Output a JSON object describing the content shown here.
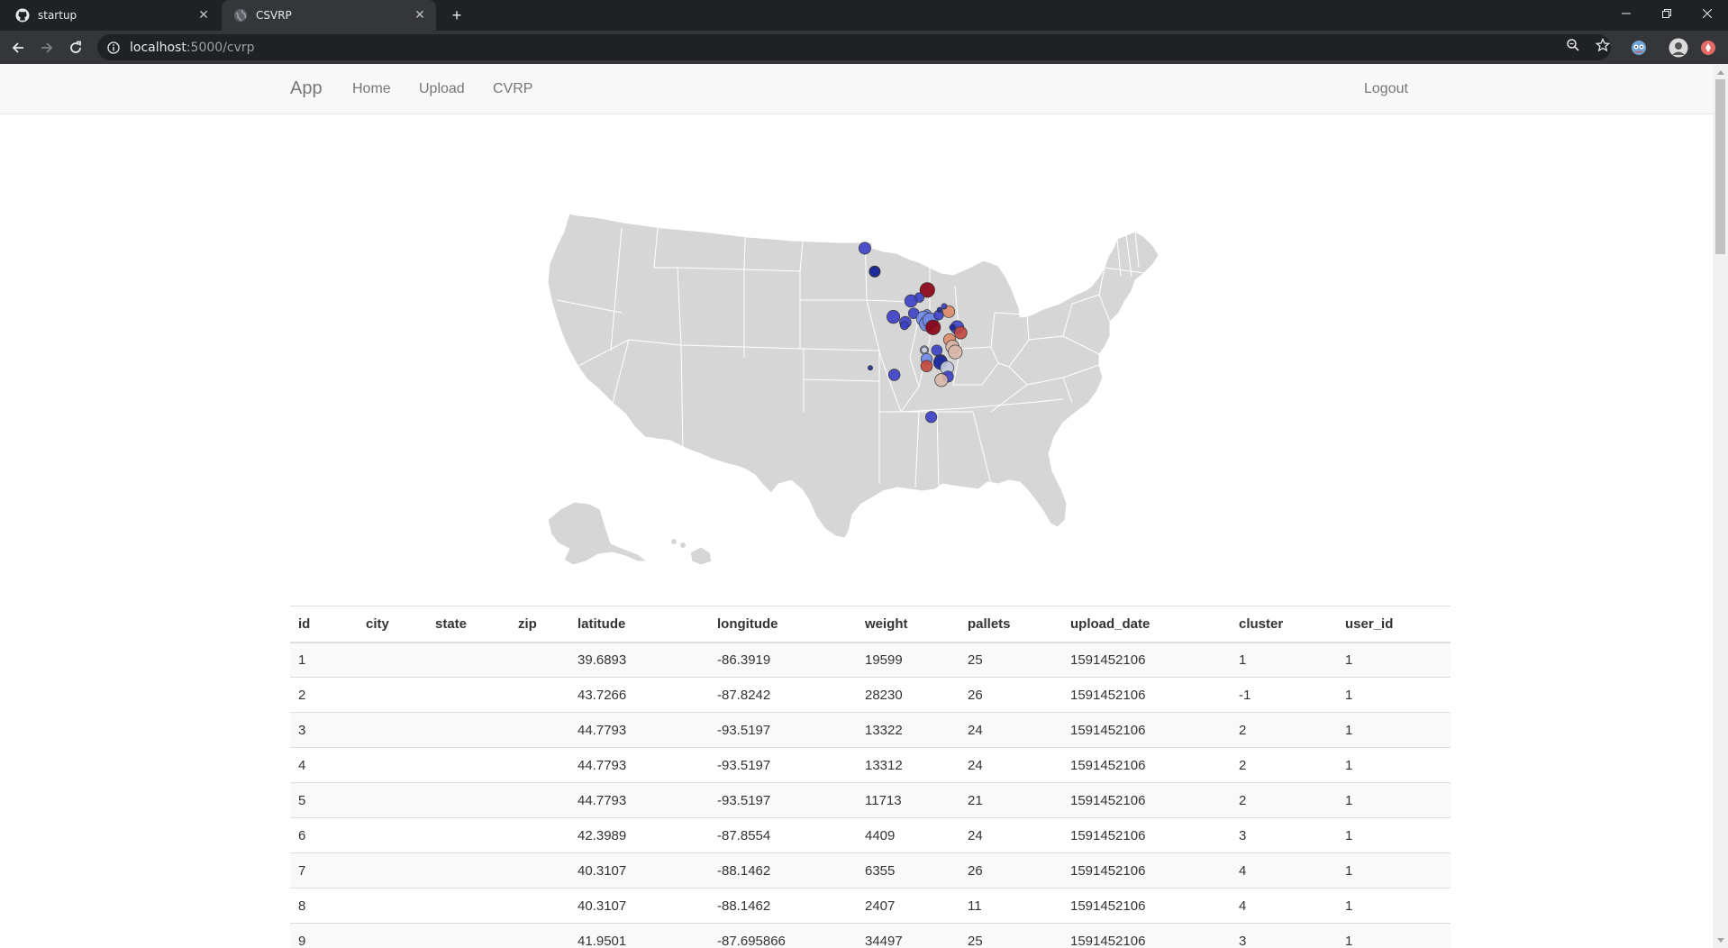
{
  "browser": {
    "tabs": [
      {
        "title": "startup",
        "icon": "github-icon"
      },
      {
        "title": "CSVRP",
        "icon": "globe-icon",
        "active": true
      }
    ],
    "url_host": "localhost",
    "url_path": ":5000/cvrp"
  },
  "navbar": {
    "brand": "App",
    "links": [
      "Home",
      "Upload",
      "CVRP"
    ],
    "logout": "Logout"
  },
  "map": {
    "title": "",
    "base_color": "#d6d6d6",
    "border_color": "#ffffff",
    "cluster_colors": {
      "-1": "#8b0012",
      "1": "#3b3fc7",
      "2": "#1d2a9b",
      "3": "#6f88e6",
      "4": "#c4cbe0",
      "5": "#e08a6a",
      "6": "#d9b8a8",
      "7": "#c4473d"
    },
    "points": [
      {
        "lat": 39.6893,
        "lon": -86.3919,
        "weight": 19599,
        "cluster": 1
      },
      {
        "lat": 43.7266,
        "lon": -87.8242,
        "weight": 28230,
        "cluster": -1
      },
      {
        "lat": 44.7793,
        "lon": -93.5197,
        "weight": 13322,
        "cluster": 2
      },
      {
        "lat": 44.7793,
        "lon": -93.5197,
        "weight": 13312,
        "cluster": 2
      },
      {
        "lat": 44.7793,
        "lon": -93.5197,
        "weight": 11713,
        "cluster": 2
      },
      {
        "lat": 42.3989,
        "lon": -87.8554,
        "weight": 4409,
        "cluster": 3
      },
      {
        "lat": 40.3107,
        "lon": -88.1462,
        "weight": 6355,
        "cluster": 4
      },
      {
        "lat": 40.3107,
        "lon": -88.1462,
        "weight": 2407,
        "cluster": 4
      },
      {
        "lat": 41.9501,
        "lon": -87.695866,
        "weight": 34497,
        "cluster": 3
      },
      {
        "lat": 46.1,
        "lon": -94.6,
        "weight": 16000,
        "cluster": 1
      },
      {
        "lat": 42.2,
        "lon": -91.5,
        "weight": 20000,
        "cluster": 1
      },
      {
        "lat": 41.9,
        "lon": -90.2,
        "weight": 15000,
        "cluster": 1
      },
      {
        "lat": 42.4,
        "lon": -89.3,
        "weight": 12000,
        "cluster": 1
      },
      {
        "lat": 43.3,
        "lon": -88.7,
        "weight": 9000,
        "cluster": 1
      },
      {
        "lat": 43.1,
        "lon": -89.6,
        "weight": 18000,
        "cluster": 1
      },
      {
        "lat": 42.1,
        "lon": -88.2,
        "weight": 30000,
        "cluster": 3
      },
      {
        "lat": 41.8,
        "lon": -87.9,
        "weight": 26000,
        "cluster": 3
      },
      {
        "lat": 42.0,
        "lon": -87.5,
        "weight": 30000,
        "cluster": 3
      },
      {
        "lat": 41.6,
        "lon": -87.2,
        "weight": 28000,
        "cluster": -1
      },
      {
        "lat": 41.6,
        "lon": -84.6,
        "weight": 22000,
        "cluster": 1
      },
      {
        "lat": 41.3,
        "lon": -84.2,
        "weight": 18000,
        "cluster": 7
      },
      {
        "lat": 42.3,
        "lon": -86.6,
        "weight": 9000,
        "cluster": 1
      },
      {
        "lat": 42.5,
        "lon": -85.5,
        "weight": 16000,
        "cluster": 5
      },
      {
        "lat": 40.9,
        "lon": -85.4,
        "weight": 17000,
        "cluster": 5
      },
      {
        "lat": 40.5,
        "lon": -85.1,
        "weight": 22000,
        "cluster": 6
      },
      {
        "lat": 40.2,
        "lon": -84.8,
        "weight": 24000,
        "cluster": 6
      },
      {
        "lat": 40.3,
        "lon": -86.8,
        "weight": 12000,
        "cluster": 1
      },
      {
        "lat": 39.8,
        "lon": -87.9,
        "weight": 14000,
        "cluster": 3
      },
      {
        "lat": 39.4,
        "lon": -87.9,
        "weight": 15000,
        "cluster": 7
      },
      {
        "lat": 39.6,
        "lon": -86.4,
        "weight": 24000,
        "cluster": 2
      },
      {
        "lat": 39.3,
        "lon": -85.7,
        "weight": 22000,
        "cluster": 4
      },
      {
        "lat": 38.8,
        "lon": -85.6,
        "weight": 14000,
        "cluster": 1
      },
      {
        "lat": 38.6,
        "lon": -86.3,
        "weight": 20000,
        "cluster": 6
      },
      {
        "lat": 38.9,
        "lon": -91.4,
        "weight": 15000,
        "cluster": 1
      },
      {
        "lat": 41.7,
        "lon": -90.3,
        "weight": 6000,
        "cluster": 1
      },
      {
        "lat": 36.5,
        "lon": -87.4,
        "weight": 14000,
        "cluster": 1
      },
      {
        "lat": 39.3,
        "lon": -94.0,
        "weight": 800,
        "cluster": 2
      },
      {
        "lat": 42.6,
        "lon": -86.5,
        "weight": 1000,
        "cluster": 2
      },
      {
        "lat": 42.8,
        "lon": -86.0,
        "weight": 1500,
        "cluster": 1
      },
      {
        "lat": 41.6,
        "lon": -85.1,
        "weight": 2000,
        "cluster": 2
      }
    ]
  },
  "table": {
    "columns": [
      "id",
      "city",
      "state",
      "zip",
      "latitude",
      "longitude",
      "weight",
      "pallets",
      "upload_date",
      "cluster",
      "user_id"
    ],
    "rows": [
      [
        "1",
        "",
        "",
        "",
        "39.6893",
        "-86.3919",
        "19599",
        "25",
        "1591452106",
        "1",
        "1"
      ],
      [
        "2",
        "",
        "",
        "",
        "43.7266",
        "-87.8242",
        "28230",
        "26",
        "1591452106",
        "-1",
        "1"
      ],
      [
        "3",
        "",
        "",
        "",
        "44.7793",
        "-93.5197",
        "13322",
        "24",
        "1591452106",
        "2",
        "1"
      ],
      [
        "4",
        "",
        "",
        "",
        "44.7793",
        "-93.5197",
        "13312",
        "24",
        "1591452106",
        "2",
        "1"
      ],
      [
        "5",
        "",
        "",
        "",
        "44.7793",
        "-93.5197",
        "11713",
        "21",
        "1591452106",
        "2",
        "1"
      ],
      [
        "6",
        "",
        "",
        "",
        "42.3989",
        "-87.8554",
        "4409",
        "24",
        "1591452106",
        "3",
        "1"
      ],
      [
        "7",
        "",
        "",
        "",
        "40.3107",
        "-88.1462",
        "6355",
        "26",
        "1591452106",
        "4",
        "1"
      ],
      [
        "8",
        "",
        "",
        "",
        "40.3107",
        "-88.1462",
        "2407",
        "11",
        "1591452106",
        "4",
        "1"
      ],
      [
        "9",
        "",
        "",
        "",
        "41.9501",
        "-87.695866",
        "34497",
        "25",
        "1591452106",
        "3",
        "1"
      ]
    ]
  }
}
